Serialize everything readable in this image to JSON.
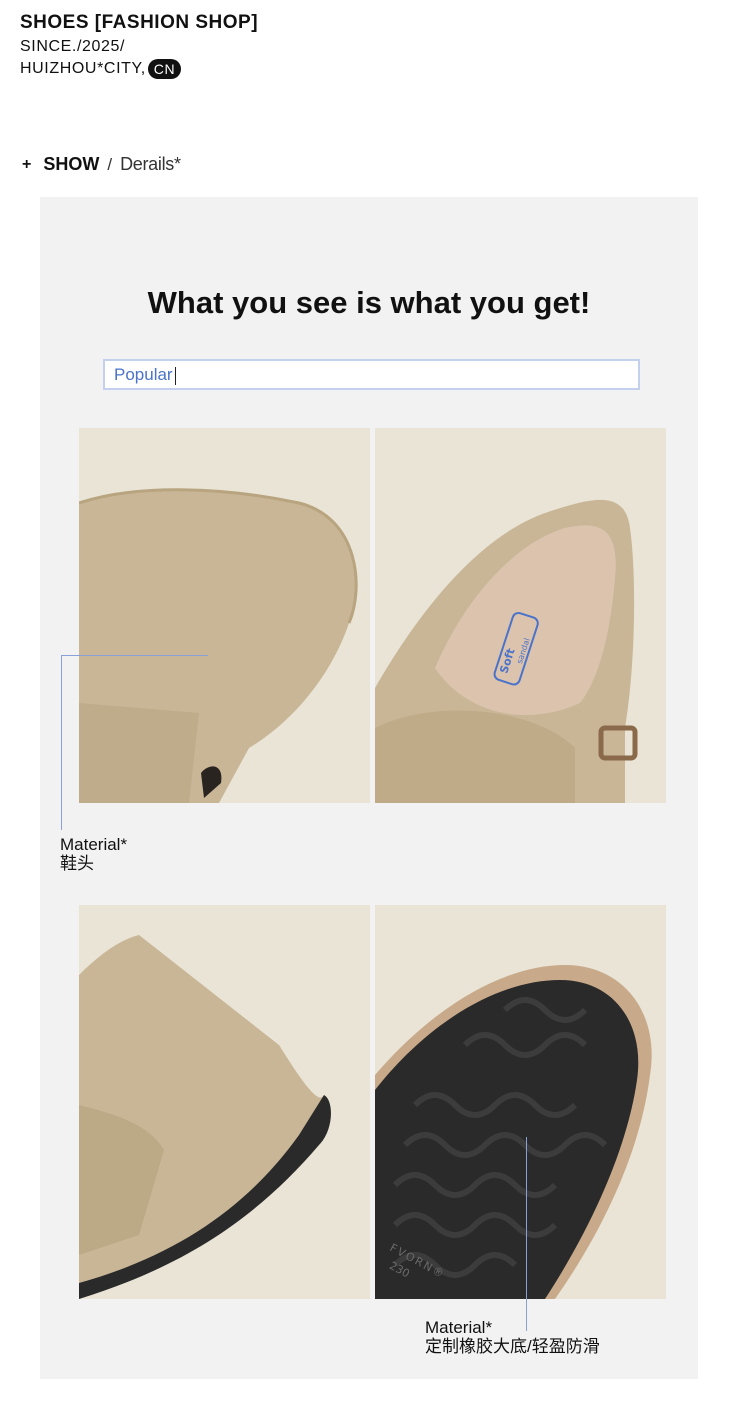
{
  "brand": {
    "title": "SHOES [FASHION SHOP]",
    "since": "SINCE./2025/",
    "city": "HUIZHOU*CITY,",
    "country_badge": "CN"
  },
  "section": {
    "plus": "+",
    "show": "SHOW",
    "separator": "/",
    "details": "Derails*"
  },
  "panel": {
    "headline": "What you see is what you get!",
    "search_value": "Popular"
  },
  "photos": {
    "insole_brand": "Soft",
    "insole_sub": "sandal",
    "sole_brand": "FVORN®",
    "sole_size": "230"
  },
  "callouts": {
    "first": {
      "title": "Material*",
      "subtitle": "鞋头"
    },
    "second": {
      "title": "Material*",
      "subtitle": "定制橡胶大底/轻盈防滑"
    }
  },
  "colors": {
    "panel_bg": "#f2f2f2",
    "photo_bg": "#e9e4d6",
    "suede": "#c9b697",
    "sole_black": "#2a2a2a",
    "accent_blue": "#4a73c9",
    "callout_line": "#8aa0d9"
  }
}
